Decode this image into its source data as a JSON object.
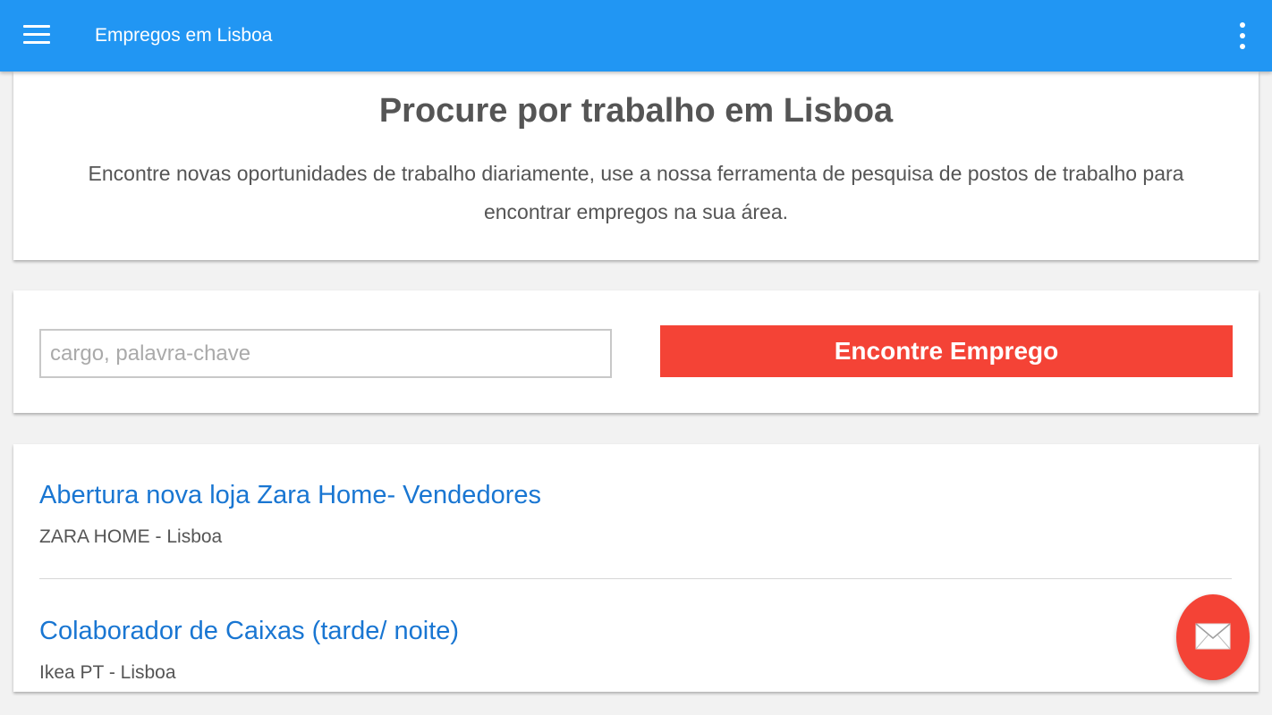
{
  "appbar": {
    "title": "Empregos em Lisboa",
    "menu_icon": "hamburger-menu-icon",
    "more_icon": "more-vert-icon",
    "color": "#2196f3"
  },
  "hero": {
    "title": "Procure por trabalho em Lisboa",
    "description": "Encontre novas oportunidades de trabalho diariamente, use a nossa ferramenta de pesquisa de postos de trabalho para encontrar empregos na sua área."
  },
  "search": {
    "value": "",
    "placeholder": "cargo, palavra-chave",
    "button_label": "Encontre Emprego",
    "button_color": "#f44336"
  },
  "jobs": [
    {
      "title": "Abertura nova loja Zara Home- Vendedores",
      "meta": "ZARA HOME - Lisboa"
    },
    {
      "title": "Colaborador de Caixas (tarde/ noite)",
      "meta": "Ikea PT - Lisboa"
    }
  ],
  "fab": {
    "icon": "envelope-icon",
    "color": "#f44336"
  }
}
